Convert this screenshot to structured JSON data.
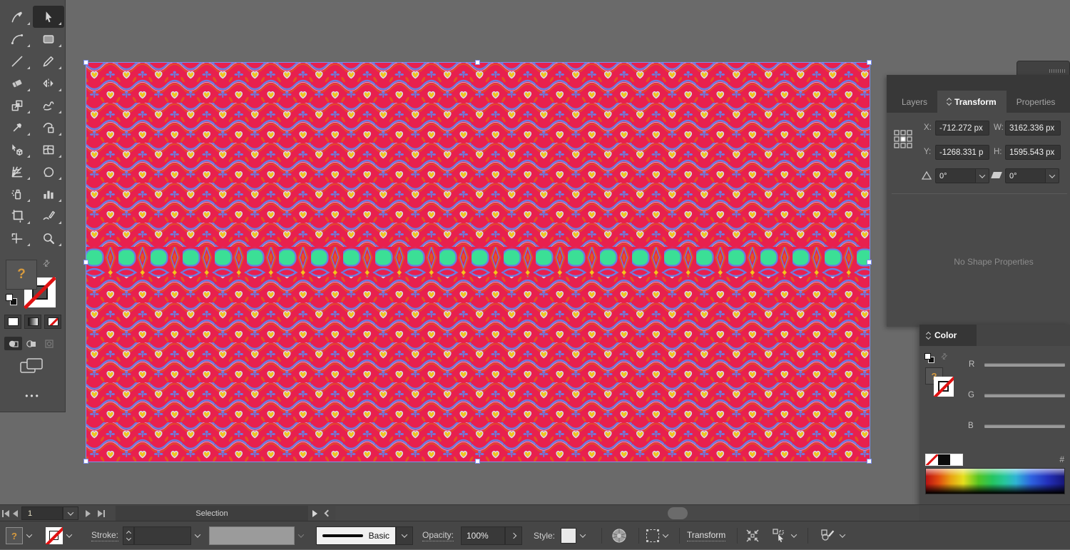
{
  "toolbar": {
    "active_tool": "selection",
    "fill_indicator": "?",
    "more_label": "•••",
    "tools": [
      "pen",
      "selection",
      "curvature",
      "rectangle",
      "line-segment",
      "pencil",
      "eraser",
      "reflect",
      "scale",
      "warp",
      "puppet-warp",
      "free-transform",
      "perspective-selection",
      "mesh",
      "perspective-grid",
      "rotate-view",
      "symbol-sprayer",
      "graph",
      "artboard",
      "shaper",
      "slice",
      "zoom"
    ]
  },
  "transform_panel": {
    "tabs": [
      {
        "label": "Layers"
      },
      {
        "label": "Transform"
      },
      {
        "label": "Properties"
      }
    ],
    "active_tab": "Transform",
    "x_label": "X:",
    "x_value": "-712.272 px",
    "y_label": "Y:",
    "y_value": "-1268.331 p",
    "w_label": "W:",
    "w_value": "3162.336 px",
    "h_label": "H:",
    "h_value": "1595.543 px",
    "rotate_value": "0°",
    "shear_value": "0°",
    "empty_message": "No Shape Properties"
  },
  "color_panel": {
    "title": "Color",
    "channel_r": "R",
    "channel_g": "G",
    "channel_b": "B",
    "hex_label": "#",
    "fill_indicator": "?"
  },
  "status_bar": {
    "artboard_number": "1",
    "status_text": "Selection"
  },
  "control_bar": {
    "fill_indicator": "?",
    "stroke_label": "Stroke:",
    "brush_name": "Basic",
    "opacity_label": "Opacity:",
    "opacity_value": "100%",
    "style_label": "Style:",
    "transform_link": "Transform"
  },
  "artwork": {
    "state": "selected",
    "colors": {
      "red": "#e8204e",
      "blue": "#6b7de0",
      "yellow": "#f2c51d",
      "orange": "#e0581e",
      "green": "#3bdf96",
      "outline": "#d8dcf0",
      "selection_accent": "#7c8ef2"
    }
  }
}
